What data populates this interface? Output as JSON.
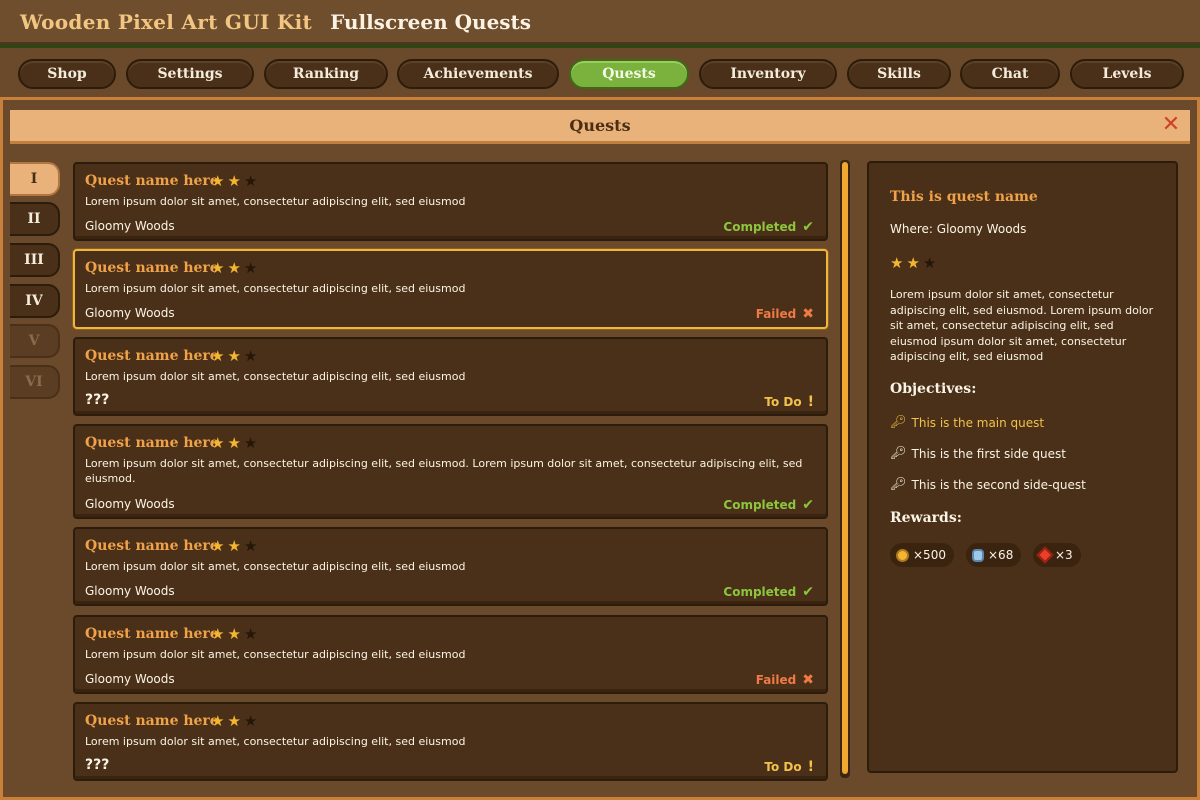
{
  "header": {
    "brand": "Wooden Pixel Art GUI Kit",
    "subtitle": "Fullscreen Quests"
  },
  "nav": {
    "tabs": [
      {
        "label": "Shop"
      },
      {
        "label": "Settings"
      },
      {
        "label": "Ranking"
      },
      {
        "label": "Achievements"
      },
      {
        "label": "Quests",
        "active": true
      },
      {
        "label": "Inventory"
      },
      {
        "label": "Skills"
      },
      {
        "label": "Chat"
      },
      {
        "label": "Levels"
      }
    ]
  },
  "panel": {
    "title": "Quests",
    "close_icon": "close-icon"
  },
  "side_tabs": [
    {
      "label": "I",
      "state": "active"
    },
    {
      "label": "II",
      "state": "normal"
    },
    {
      "label": "III",
      "state": "normal"
    },
    {
      "label": "IV",
      "state": "normal"
    },
    {
      "label": "V",
      "state": "disabled"
    },
    {
      "label": "VI",
      "state": "disabled"
    }
  ],
  "quests": [
    {
      "name": "Quest name here",
      "stars": 2,
      "max_stars": 3,
      "desc": "Lorem ipsum dolor sit amet, consectetur adipiscing elit, sed eiusmod",
      "location": "Gloomy Woods",
      "status": "Completed",
      "status_icon": "check-icon",
      "selected": false
    },
    {
      "name": "Quest name here",
      "stars": 2,
      "max_stars": 3,
      "desc": "Lorem ipsum dolor sit amet, consectetur adipiscing elit, sed eiusmod",
      "location": "Gloomy Woods",
      "status": "Failed",
      "status_icon": "cross-icon",
      "selected": true
    },
    {
      "name": "Quest name here",
      "stars": 2,
      "max_stars": 3,
      "desc": "Lorem ipsum dolor sit amet, consectetur adipiscing elit, sed eiusmod",
      "location": "???",
      "status": "To Do",
      "status_icon": "exclamation-icon",
      "selected": false
    },
    {
      "name": "Quest name here",
      "stars": 2,
      "max_stars": 3,
      "desc": "Lorem ipsum dolor sit amet, consectetur adipiscing elit, sed eiusmod. Lorem ipsum dolor sit amet, consectetur adipiscing elit, sed eiusmod.",
      "location": "Gloomy Woods",
      "status": "Completed",
      "status_icon": "check-icon",
      "selected": false
    },
    {
      "name": "Quest name here",
      "stars": 2,
      "max_stars": 3,
      "desc": "Lorem ipsum dolor sit amet, consectetur adipiscing elit, sed eiusmod",
      "location": "Gloomy Woods",
      "status": "Completed",
      "status_icon": "check-icon",
      "selected": false
    },
    {
      "name": "Quest name here",
      "stars": 2,
      "max_stars": 3,
      "desc": "Lorem ipsum dolor sit amet, consectetur adipiscing elit, sed eiusmod",
      "location": "Gloomy Woods",
      "status": "Failed",
      "status_icon": "cross-icon",
      "selected": false
    },
    {
      "name": "Quest name here",
      "stars": 2,
      "max_stars": 3,
      "desc": "Lorem ipsum dolor sit amet, consectetur adipiscing elit, sed eiusmod",
      "location": "???",
      "status": "To Do",
      "status_icon": "exclamation-icon",
      "selected": false
    }
  ],
  "detail": {
    "title": "This is quest name",
    "where": "Where: Gloomy Woods",
    "stars": 2,
    "max_stars": 3,
    "desc": "Lorem ipsum dolor sit amet, consectetur adipiscing elit, sed eiusmod. Lorem ipsum dolor sit amet, consectetur adipiscing elit, sed eiusmod ipsum dolor sit amet, consectetur adipiscing elit, sed eiusmod",
    "objectives_heading": "Objectives:",
    "objectives": [
      {
        "label": "This is the main quest",
        "type": "main"
      },
      {
        "label": "This is the first side quest",
        "type": "side"
      },
      {
        "label": "This is the second side-quest",
        "type": "side"
      }
    ],
    "rewards_heading": "Rewards:",
    "rewards": [
      {
        "icon": "coin-icon",
        "amount": "×500"
      },
      {
        "icon": "blue-gem-icon",
        "amount": "×68"
      },
      {
        "icon": "red-gem-icon",
        "amount": "×3"
      }
    ]
  },
  "colors": {
    "accent_green": "#7bb23e",
    "quest_name": "#f0a24a",
    "completed": "#8cc63e",
    "failed": "#f07a45",
    "todo": "#f2c24a"
  }
}
